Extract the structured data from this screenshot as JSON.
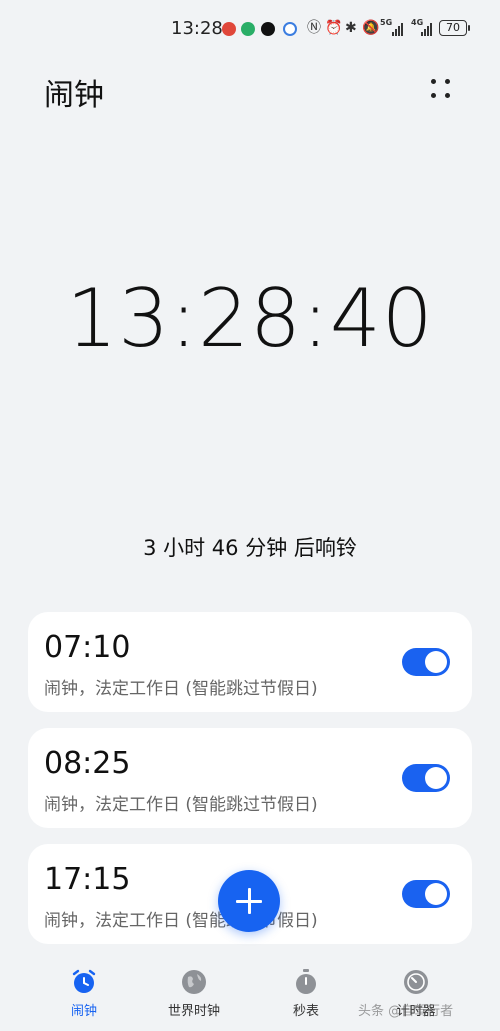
{
  "status_bar": {
    "time": "13:28",
    "network_5g": "5G",
    "network_4g": "4G",
    "battery": "70",
    "icons": [
      "weibo-icon",
      "wechat-icon",
      "tiktok-icon",
      "app-icon",
      "nfc-icon",
      "alarm-icon",
      "bluetooth-icon",
      "mute-icon",
      "signal-icon",
      "signal-icon"
    ]
  },
  "header": {
    "title": "闹钟"
  },
  "clock": {
    "current_time": "13:28:40",
    "countdown": "3 小时 46 分钟 后响铃"
  },
  "alarms": [
    {
      "time": "07:10",
      "description": "闹钟，法定工作日 (智能跳过节假日)",
      "enabled": true
    },
    {
      "time": "08:25",
      "description": "闹钟，法定工作日 (智能跳过节假日)",
      "enabled": true
    },
    {
      "time": "17:15",
      "description": "闹钟，法定工作日 (智能跳过节假日)",
      "enabled": true
    }
  ],
  "nav": {
    "items": [
      {
        "label": "闹钟",
        "icon": "alarm-clock-icon",
        "active": true
      },
      {
        "label": "世界时钟",
        "icon": "globe-icon",
        "active": false
      },
      {
        "label": "秒表",
        "icon": "stopwatch-icon",
        "active": false
      },
      {
        "label": "计时器",
        "icon": "timer-icon",
        "active": false
      }
    ]
  },
  "watermark": "头条 @自驾行者",
  "colors": {
    "accent": "#1763f1",
    "background": "#f1f3f5",
    "card": "#ffffff"
  }
}
